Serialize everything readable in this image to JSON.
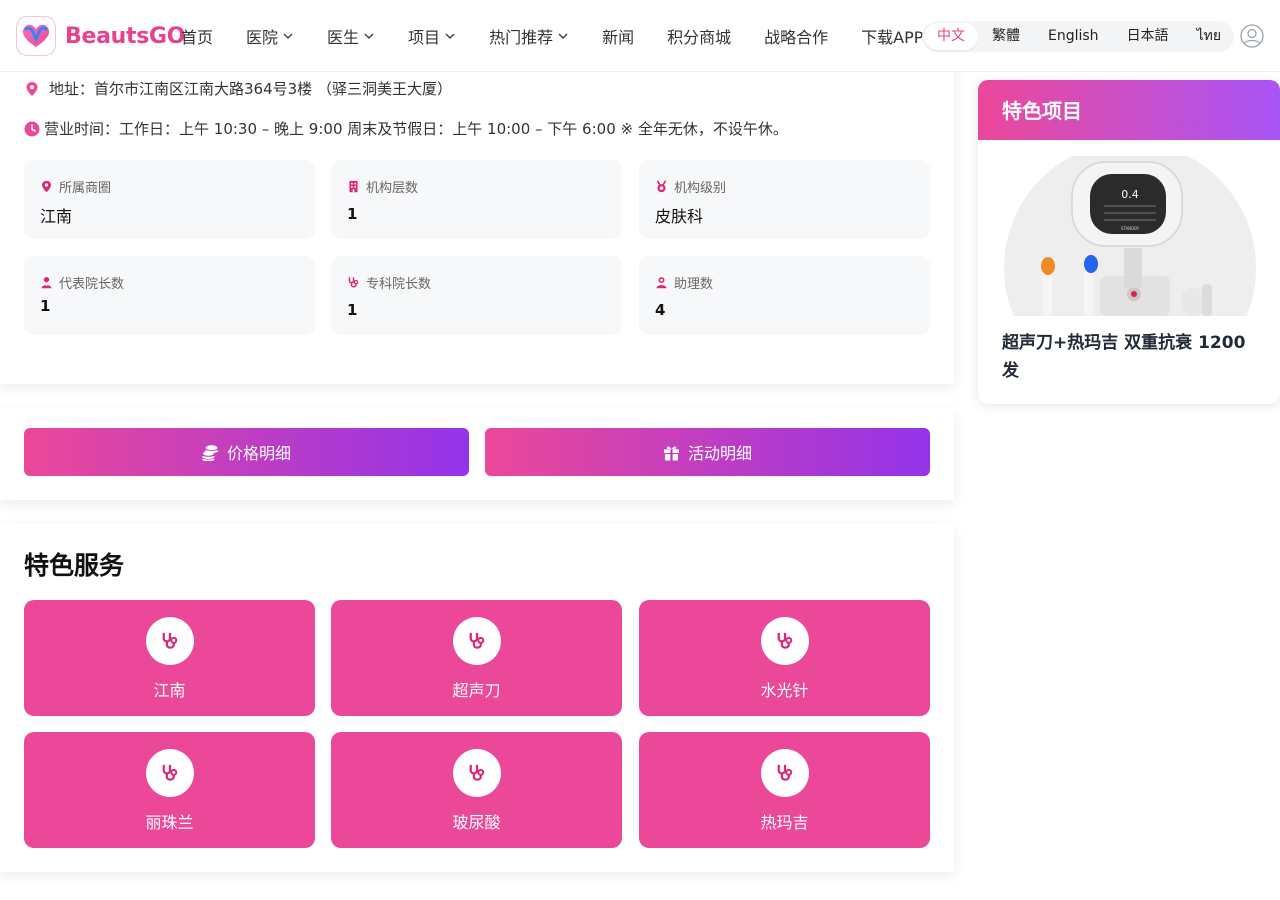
{
  "brand": {
    "name": "BeautsGO"
  },
  "nav": {
    "items": [
      {
        "label": "首页",
        "dropdown": false
      },
      {
        "label": "医院",
        "dropdown": true
      },
      {
        "label": "医生",
        "dropdown": true
      },
      {
        "label": "项目",
        "dropdown": true
      },
      {
        "label": "热门推荐",
        "dropdown": true
      },
      {
        "label": "新闻",
        "dropdown": false
      },
      {
        "label": "积分商城",
        "dropdown": false
      },
      {
        "label": "战略合作",
        "dropdown": false
      },
      {
        "label": "下载APP",
        "dropdown": false
      }
    ]
  },
  "languages": {
    "items": [
      "中文",
      "繁體",
      "English",
      "日本語",
      "ไทย"
    ],
    "selected": "中文"
  },
  "info": {
    "address": "地址：首尔市江南区江南大路364号3楼 （驿三洞美王大厦）",
    "hours": "营业时间：工作日：上午 10:30 – 晚上 9:00 周末及节假日：上午 10:00 – 下午 6:00 ※ 全年无休，不设午休。"
  },
  "stats": [
    {
      "label": "所属商圈",
      "value": "江南",
      "icon": "map-pin-icon"
    },
    {
      "label": "机构层数",
      "value": "1",
      "icon": "building-icon"
    },
    {
      "label": "机构级别",
      "value": "皮肤科",
      "icon": "medal-icon"
    },
    {
      "label": "代表院长数",
      "value": "1",
      "icon": "doctor-icon"
    },
    {
      "label": "专科院长数",
      "value": "1",
      "icon": "stethoscope-icon"
    },
    {
      "label": "助理数",
      "value": "4",
      "icon": "assistant-icon"
    }
  ],
  "actions": {
    "price_label": "价格明细",
    "activity_label": "活动明细"
  },
  "services": {
    "title": "特色服务",
    "items": [
      "江南",
      "超声刀",
      "水光针",
      "丽珠兰",
      "玻尿酸",
      "热玛吉"
    ]
  },
  "sidebar": {
    "title": "特色项目",
    "item_title": "超声刀+热玛吉 双重抗衰 1200发",
    "device_display": "0.4",
    "device_brand": "STANDBY"
  },
  "colors": {
    "brand_pink": "#ec4899",
    "brand_purple": "#9333ea",
    "logo_pink": "#e8418f"
  }
}
